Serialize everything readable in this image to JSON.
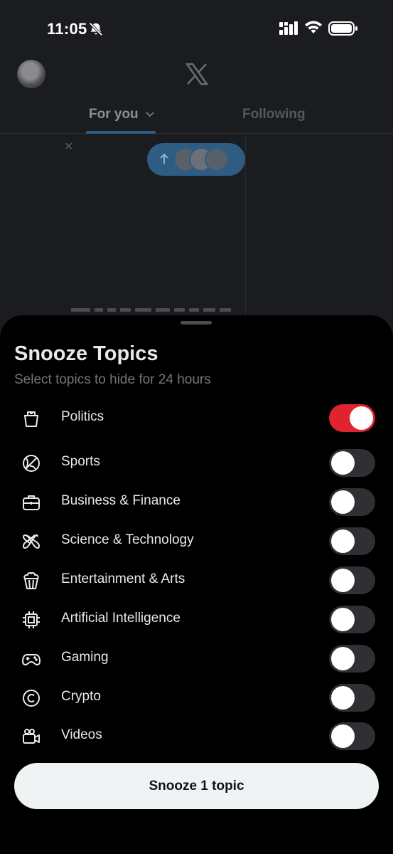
{
  "status_bar": {
    "time": "11:05",
    "icons": [
      "bell-muted-icon",
      "cellular-signal-icon",
      "wifi-icon",
      "battery-icon"
    ]
  },
  "header": {
    "logo": "x-logo",
    "tabs": [
      {
        "label": "For you",
        "selected": true
      },
      {
        "label": "Following",
        "selected": false
      }
    ]
  },
  "snooze_sheet": {
    "title": "Snooze Topics",
    "subtitle": "Select topics to hide for 24 hours",
    "topics": [
      {
        "label": "Politics",
        "icon": "ballot-box-icon",
        "enabled": true
      },
      {
        "label": "Sports",
        "icon": "ball-icon",
        "enabled": false
      },
      {
        "label": "Business & Finance",
        "icon": "briefcase-icon",
        "enabled": false
      },
      {
        "label": "Science & Technology",
        "icon": "atom-icon",
        "enabled": false
      },
      {
        "label": "Entertainment & Arts",
        "icon": "popcorn-icon",
        "enabled": false
      },
      {
        "label": "Artificial Intelligence",
        "icon": "cpu-chip-icon",
        "enabled": false
      },
      {
        "label": "Gaming",
        "icon": "gamepad-icon",
        "enabled": false
      },
      {
        "label": "Crypto",
        "icon": "coin-icon",
        "enabled": false
      },
      {
        "label": "Videos",
        "icon": "video-camera-icon",
        "enabled": false
      }
    ],
    "action_label": "Snooze 1 topic"
  },
  "colors": {
    "toggle_on": "#e0242f",
    "toggle_off": "#2f3034",
    "sheet_bg": "#000000",
    "button_bg": "#eff3f4"
  }
}
